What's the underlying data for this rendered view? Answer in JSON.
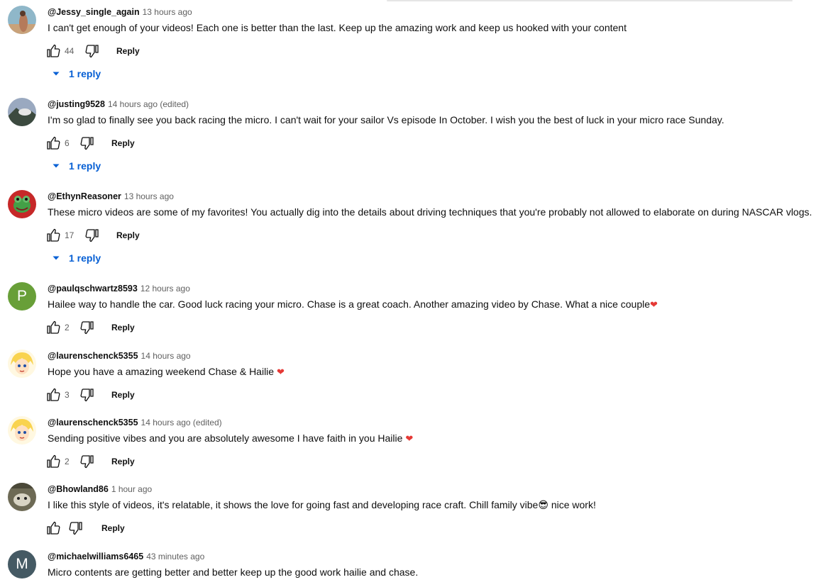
{
  "comments": [
    {
      "author": "@Jessy_single_again",
      "time": "13 hours ago",
      "text": "I can't get enough of your videos! Each one is better than the last. Keep up the amazing work and keep us hooked with your content",
      "suffix": "",
      "likes": "44",
      "reply_label": "Reply",
      "replies_label": "1 reply",
      "avatar": "photo-figure-icon"
    },
    {
      "author": "@justing9528",
      "time": "14 hours ago (edited)",
      "text": "I'm so glad to finally see you back racing the micro. I can't wait for your sailor Vs episode In October. I wish you the best of luck in your micro race Sunday.",
      "suffix": "",
      "likes": "6",
      "reply_label": "Reply",
      "replies_label": "1 reply",
      "avatar": "photo-landscape-icon"
    },
    {
      "author": "@EthynReasoner",
      "time": "13 hours ago",
      "text": "These micro videos are some of my favorites! You actually dig into the details about driving techniques that you're probably not allowed to elaborate on during NASCAR vlogs.",
      "suffix": "",
      "likes": "17",
      "reply_label": "Reply",
      "replies_label": "1 reply",
      "avatar": "frog-character-icon"
    },
    {
      "author": "@paulqschwartz8593",
      "time": "12 hours ago",
      "text": "Hailee way to handle the car. Good luck racing your micro. Chase is a great coach. Another amazing video by Chase. What a nice couple",
      "suffix": "❤",
      "likes": "2",
      "reply_label": "Reply",
      "replies_label": "",
      "avatar_letter": "P",
      "avatar_color": "#689f38"
    },
    {
      "author": "@laurenschenck5355",
      "time": "14 hours ago",
      "text": "Hope you have a amazing weekend Chase & Hailie ",
      "suffix": "❤",
      "likes": "3",
      "reply_label": "Reply",
      "replies_label": "",
      "avatar": "anime-character-icon"
    },
    {
      "author": "@laurenschenck5355",
      "time": "14 hours ago (edited)",
      "text": "Sending positive vibes and you are absolutely awesome I have faith in you Hailie ",
      "suffix": "❤",
      "likes": "2",
      "reply_label": "Reply",
      "replies_label": "",
      "avatar": "anime-character-icon"
    },
    {
      "author": "@Bhowland86",
      "time": "1 hour ago",
      "text": "I like this style of videos, it's relatable, it shows the love for going fast and developing race craft. Chill family vibe",
      "suffix": "😎",
      "suffix2": " nice work!",
      "likes": "",
      "reply_label": "Reply",
      "replies_label": "",
      "avatar": "photo-animal-icon"
    },
    {
      "author": "@michaelwilliams6465",
      "time": "43 minutes ago",
      "text": "Micro contents are getting better and better keep up the good work hailie and chase.",
      "suffix": "",
      "likes": "",
      "reply_label": "",
      "replies_label": "",
      "avatar_letter": "M",
      "avatar_color": "#455a64"
    }
  ],
  "colors": {
    "link_blue": "#065fd4",
    "heart_red": "#e53935",
    "meta_gray": "#606060"
  },
  "icons": {
    "like": "thumbs-up-icon",
    "dislike": "thumbs-down-icon",
    "expand": "caret-down-icon"
  }
}
